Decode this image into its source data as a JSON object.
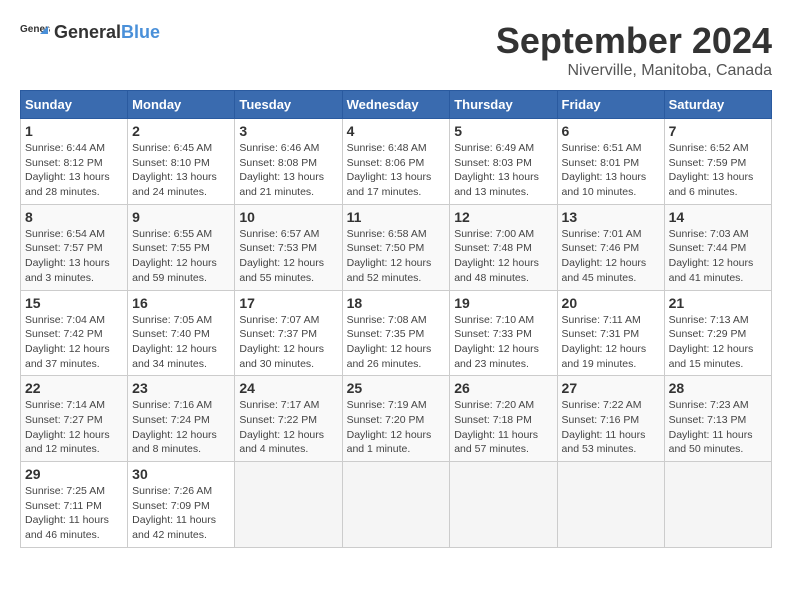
{
  "header": {
    "logo_general": "General",
    "logo_blue": "Blue",
    "month_title": "September 2024",
    "location": "Niverville, Manitoba, Canada"
  },
  "columns": [
    "Sunday",
    "Monday",
    "Tuesday",
    "Wednesday",
    "Thursday",
    "Friday",
    "Saturday"
  ],
  "weeks": [
    [
      {
        "day": "1",
        "info": "Sunrise: 6:44 AM\nSunset: 8:12 PM\nDaylight: 13 hours\nand 28 minutes."
      },
      {
        "day": "2",
        "info": "Sunrise: 6:45 AM\nSunset: 8:10 PM\nDaylight: 13 hours\nand 24 minutes."
      },
      {
        "day": "3",
        "info": "Sunrise: 6:46 AM\nSunset: 8:08 PM\nDaylight: 13 hours\nand 21 minutes."
      },
      {
        "day": "4",
        "info": "Sunrise: 6:48 AM\nSunset: 8:06 PM\nDaylight: 13 hours\nand 17 minutes."
      },
      {
        "day": "5",
        "info": "Sunrise: 6:49 AM\nSunset: 8:03 PM\nDaylight: 13 hours\nand 13 minutes."
      },
      {
        "day": "6",
        "info": "Sunrise: 6:51 AM\nSunset: 8:01 PM\nDaylight: 13 hours\nand 10 minutes."
      },
      {
        "day": "7",
        "info": "Sunrise: 6:52 AM\nSunset: 7:59 PM\nDaylight: 13 hours\nand 6 minutes."
      }
    ],
    [
      {
        "day": "8",
        "info": "Sunrise: 6:54 AM\nSunset: 7:57 PM\nDaylight: 13 hours\nand 3 minutes."
      },
      {
        "day": "9",
        "info": "Sunrise: 6:55 AM\nSunset: 7:55 PM\nDaylight: 12 hours\nand 59 minutes."
      },
      {
        "day": "10",
        "info": "Sunrise: 6:57 AM\nSunset: 7:53 PM\nDaylight: 12 hours\nand 55 minutes."
      },
      {
        "day": "11",
        "info": "Sunrise: 6:58 AM\nSunset: 7:50 PM\nDaylight: 12 hours\nand 52 minutes."
      },
      {
        "day": "12",
        "info": "Sunrise: 7:00 AM\nSunset: 7:48 PM\nDaylight: 12 hours\nand 48 minutes."
      },
      {
        "day": "13",
        "info": "Sunrise: 7:01 AM\nSunset: 7:46 PM\nDaylight: 12 hours\nand 45 minutes."
      },
      {
        "day": "14",
        "info": "Sunrise: 7:03 AM\nSunset: 7:44 PM\nDaylight: 12 hours\nand 41 minutes."
      }
    ],
    [
      {
        "day": "15",
        "info": "Sunrise: 7:04 AM\nSunset: 7:42 PM\nDaylight: 12 hours\nand 37 minutes."
      },
      {
        "day": "16",
        "info": "Sunrise: 7:05 AM\nSunset: 7:40 PM\nDaylight: 12 hours\nand 34 minutes."
      },
      {
        "day": "17",
        "info": "Sunrise: 7:07 AM\nSunset: 7:37 PM\nDaylight: 12 hours\nand 30 minutes."
      },
      {
        "day": "18",
        "info": "Sunrise: 7:08 AM\nSunset: 7:35 PM\nDaylight: 12 hours\nand 26 minutes."
      },
      {
        "day": "19",
        "info": "Sunrise: 7:10 AM\nSunset: 7:33 PM\nDaylight: 12 hours\nand 23 minutes."
      },
      {
        "day": "20",
        "info": "Sunrise: 7:11 AM\nSunset: 7:31 PM\nDaylight: 12 hours\nand 19 minutes."
      },
      {
        "day": "21",
        "info": "Sunrise: 7:13 AM\nSunset: 7:29 PM\nDaylight: 12 hours\nand 15 minutes."
      }
    ],
    [
      {
        "day": "22",
        "info": "Sunrise: 7:14 AM\nSunset: 7:27 PM\nDaylight: 12 hours\nand 12 minutes."
      },
      {
        "day": "23",
        "info": "Sunrise: 7:16 AM\nSunset: 7:24 PM\nDaylight: 12 hours\nand 8 minutes."
      },
      {
        "day": "24",
        "info": "Sunrise: 7:17 AM\nSunset: 7:22 PM\nDaylight: 12 hours\nand 4 minutes."
      },
      {
        "day": "25",
        "info": "Sunrise: 7:19 AM\nSunset: 7:20 PM\nDaylight: 12 hours\nand 1 minute."
      },
      {
        "day": "26",
        "info": "Sunrise: 7:20 AM\nSunset: 7:18 PM\nDaylight: 11 hours\nand 57 minutes."
      },
      {
        "day": "27",
        "info": "Sunrise: 7:22 AM\nSunset: 7:16 PM\nDaylight: 11 hours\nand 53 minutes."
      },
      {
        "day": "28",
        "info": "Sunrise: 7:23 AM\nSunset: 7:13 PM\nDaylight: 11 hours\nand 50 minutes."
      }
    ],
    [
      {
        "day": "29",
        "info": "Sunrise: 7:25 AM\nSunset: 7:11 PM\nDaylight: 11 hours\nand 46 minutes."
      },
      {
        "day": "30",
        "info": "Sunrise: 7:26 AM\nSunset: 7:09 PM\nDaylight: 11 hours\nand 42 minutes."
      },
      {
        "day": "",
        "info": ""
      },
      {
        "day": "",
        "info": ""
      },
      {
        "day": "",
        "info": ""
      },
      {
        "day": "",
        "info": ""
      },
      {
        "day": "",
        "info": ""
      }
    ]
  ]
}
